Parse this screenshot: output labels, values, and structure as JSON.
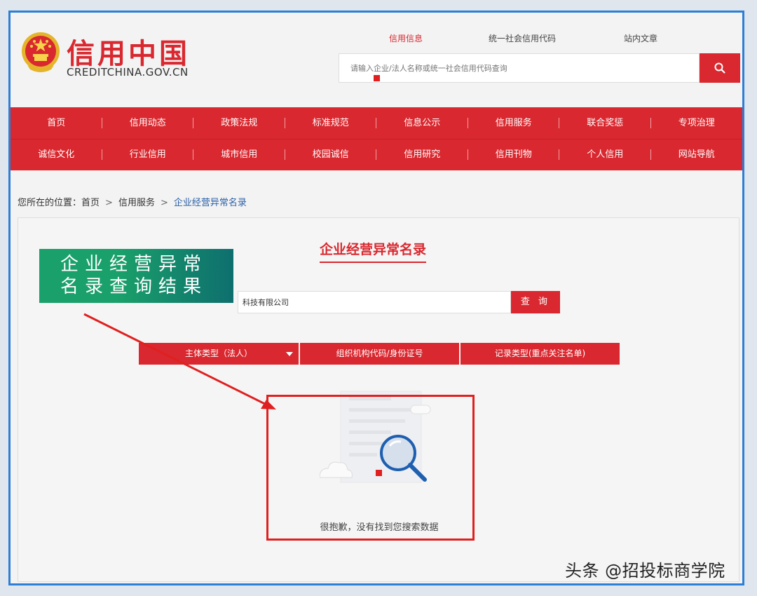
{
  "site": {
    "logo_title": "信用中国",
    "logo_subtitle": "CREDITCHINA.GOV.CN"
  },
  "search": {
    "tabs": [
      {
        "label": "信用信息",
        "active": true
      },
      {
        "label": "统一社会信用代码",
        "active": false
      },
      {
        "label": "站内文章",
        "active": false
      }
    ],
    "placeholder": "请输入企业/法人名称或统一社会信用代码查询",
    "button_icon": "search-icon"
  },
  "nav": {
    "row1": [
      "首页",
      "信用动态",
      "政策法规",
      "标准规范",
      "信息公示",
      "信用服务",
      "联合奖惩",
      "专项治理"
    ],
    "row2": [
      "诚信文化",
      "行业信用",
      "城市信用",
      "校园诚信",
      "信用研究",
      "信用刊物",
      "个人信用",
      "网站导航"
    ]
  },
  "breadcrumb": {
    "prefix": "您所在的位置：",
    "items": [
      "首页",
      "信用服务"
    ],
    "separator": ">",
    "current": "企业经营异常名录"
  },
  "content": {
    "title": "企业经营异常名录",
    "query_value": "科技有限公司",
    "query_button": "查 询",
    "filters": [
      "主体类型（法人）",
      "组织机构代码/身份证号",
      "记录类型(重点关注名单)"
    ],
    "empty_message": "很抱歉，没有找到您搜索数据"
  },
  "annotation": {
    "line1": "企业经营异常",
    "line2": "名录查询结果"
  },
  "watermark": "头条 @招投标商学院",
  "colors": {
    "brand_red": "#d9282f",
    "frame_blue": "#2d7fd6",
    "annotation_red": "#e02020",
    "banner_green": "#1aa06a"
  }
}
